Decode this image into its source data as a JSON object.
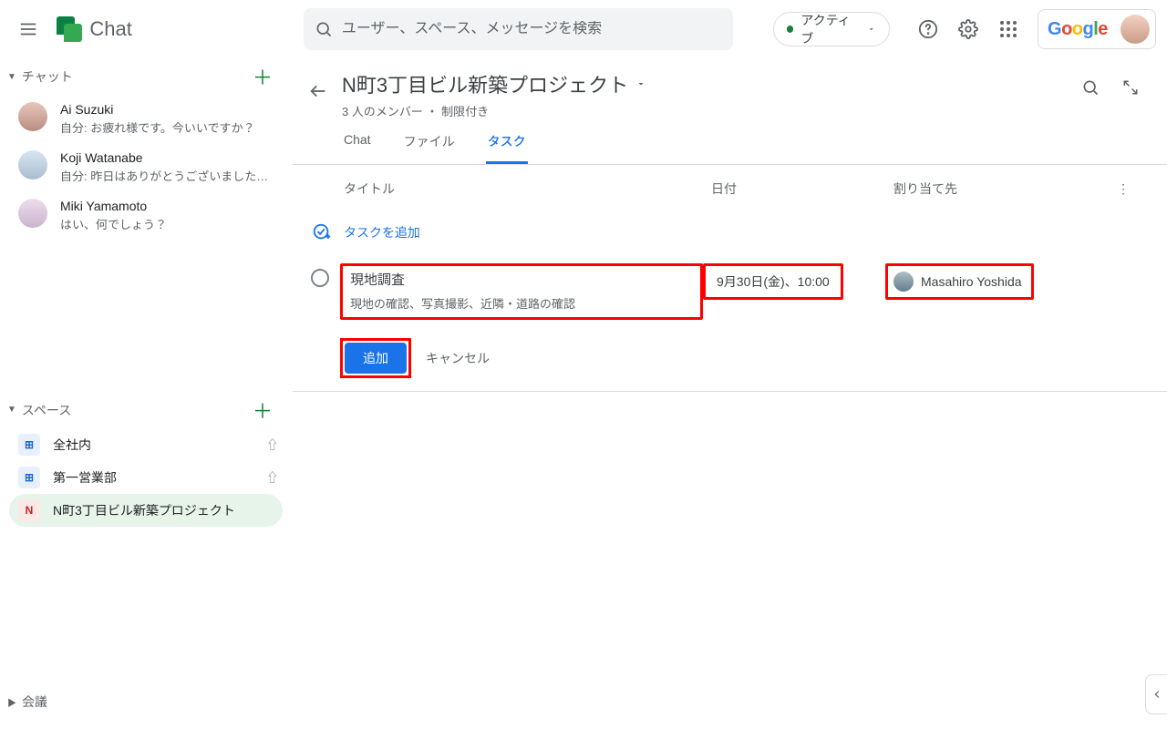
{
  "header": {
    "app_name": "Chat",
    "search_placeholder": "ユーザー、スペース、メッセージを検索",
    "status_label": "アクティブ"
  },
  "sidebar": {
    "chat_label": "チャット",
    "spaces_label": "スペース",
    "meet_label": "会議",
    "chats": [
      {
        "name": "Ai Suzuki",
        "preview": "自分: お疲れ様です。今いいですか？"
      },
      {
        "name": "Koji Watanabe",
        "preview": "自分: 昨日はありがとうございました…"
      },
      {
        "name": "Miki Yamamoto",
        "preview": "はい、何でしょう？"
      }
    ],
    "spaces": [
      {
        "label": "全社内",
        "icon": "⊞"
      },
      {
        "label": "第一営業部",
        "icon": "⊞"
      },
      {
        "label": "N町3丁目ビル新築プロジェクト",
        "icon": "N"
      }
    ]
  },
  "space": {
    "title": "N町3丁目ビル新築プロジェクト",
    "subtitle": "3 人のメンバー ・ 制限付き",
    "tabs": {
      "chat": "Chat",
      "files": "ファイル",
      "tasks": "タスク"
    },
    "columns": {
      "title": "タイトル",
      "date": "日付",
      "assignee": "割り当て先"
    },
    "add_task": "タスクを追加",
    "task": {
      "title": "現地調査",
      "detail": "現地の確認、写真撮影、近隣・道路の確認",
      "date": "9月30日(金)、10:00",
      "assignee": "Masahiro Yoshida"
    },
    "buttons": {
      "add": "追加",
      "cancel": "キャンセル"
    }
  }
}
